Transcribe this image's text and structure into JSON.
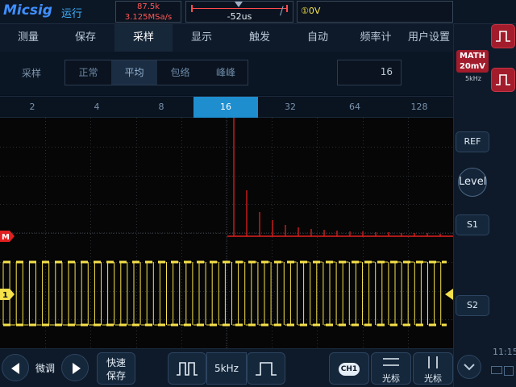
{
  "topbar": {
    "brand": "Micsig",
    "run_state": "运行",
    "memory_depth": "87.5k",
    "sample_rate": "3.125MSa/s",
    "timebase": "-52us",
    "trigger_slope": "/",
    "trigger_level": "①0V"
  },
  "menu": {
    "tabs": [
      {
        "label": "测量"
      },
      {
        "label": "保存"
      },
      {
        "label": "采样",
        "active": true
      },
      {
        "label": "显示"
      },
      {
        "label": "触发"
      },
      {
        "label": "自动"
      },
      {
        "label": "频率计"
      },
      {
        "label": "用户设置"
      }
    ]
  },
  "sampling": {
    "label": "采样",
    "modes": [
      {
        "label": "正常"
      },
      {
        "label": "平均",
        "active": true
      },
      {
        "label": "包络"
      },
      {
        "label": "峰峰"
      }
    ],
    "average_count": "16"
  },
  "count_options": [
    {
      "label": "2"
    },
    {
      "label": "4"
    },
    {
      "label": "8"
    },
    {
      "label": "16",
      "active": true
    },
    {
      "label": "32"
    },
    {
      "label": "64"
    },
    {
      "label": "128"
    }
  ],
  "channels": {
    "math_marker": "M",
    "ch1_marker": "1"
  },
  "right_panel": {
    "math_label": "MATH",
    "math_scale": "20mV",
    "math_freq": "5kHz",
    "ref_label": "REF",
    "level_label": "Level",
    "s1_label": "S1",
    "s2_label": "S2",
    "clock": "11:15"
  },
  "bottom": {
    "fine_label": "微调",
    "quick_save_line1": "快速",
    "quick_save_line2": "保存",
    "freq_label": "5kHz",
    "ch_label": "CH1",
    "cursor_h_label": "光标",
    "cursor_v_label": "光标"
  },
  "colors": {
    "accent": "#1f8ecf",
    "math_trace": "#e02020",
    "ch1_trace": "#f5e14a",
    "math_badge": "#a21c2c"
  }
}
